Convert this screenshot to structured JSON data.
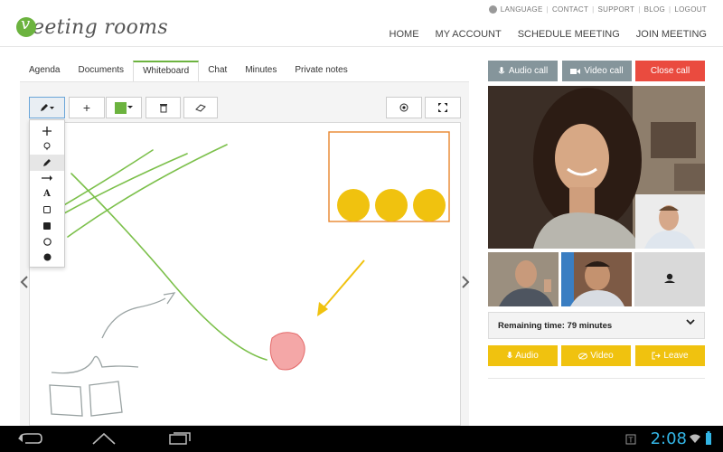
{
  "brand": {
    "logo_text": "eeting rooms"
  },
  "util_nav": [
    "LANGUAGE",
    "CONTACT",
    "SUPPORT",
    "BLOG",
    "LOGOUT"
  ],
  "main_nav": [
    "HOME",
    "MY ACCOUNT",
    "SCHEDULE MEETING",
    "JOIN MEETING"
  ],
  "tabs": [
    "Agenda",
    "Documents",
    "Whiteboard",
    "Chat",
    "Minutes",
    "Private notes"
  ],
  "active_tab": "Whiteboard",
  "toolbar": {
    "pen_icon": "pencil-icon",
    "add_label": "+",
    "color": "#6cb33f"
  },
  "tools": [
    "move-icon",
    "highlighter-icon",
    "pencil-icon",
    "arrow-icon",
    "text-icon",
    "rectangle-outline-icon",
    "rectangle-filled-icon",
    "circle-outline-icon",
    "circle-filled-icon"
  ],
  "tools_text_label": "A",
  "call": {
    "audio_call": "Audio call",
    "video_call": "Video call",
    "close_call": "Close call"
  },
  "remaining": "Remaining time: 79 minutes",
  "actions": {
    "audio": "Audio",
    "video": "Video",
    "leave": "Leave"
  },
  "status": {
    "clock": "2:08"
  },
  "colors": {
    "accent_green": "#6cb33f",
    "drawing_orange": "#e8852e",
    "drawing_yellow": "#f0c20f",
    "call_gray": "#85959b",
    "close_red": "#ea4b3f"
  }
}
